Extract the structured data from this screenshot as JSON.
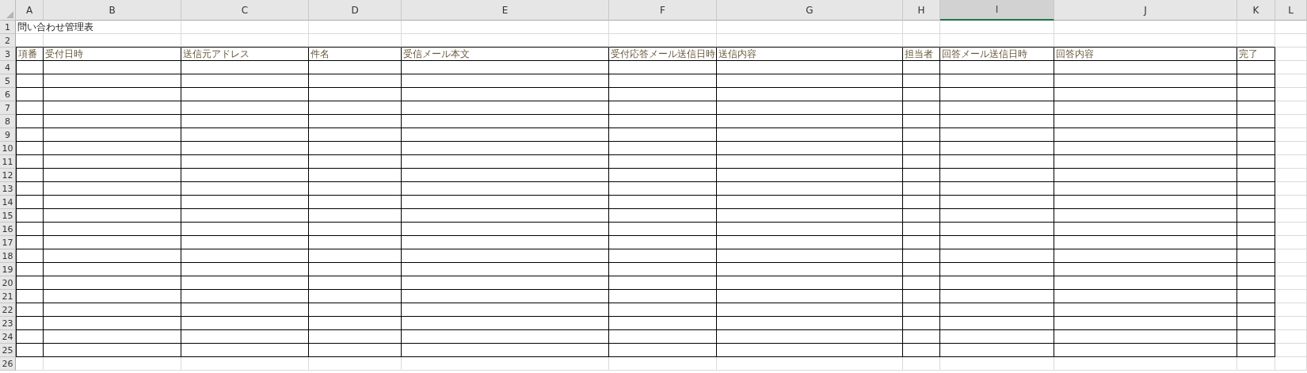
{
  "columns": [
    {
      "label": "A",
      "selected": false
    },
    {
      "label": "B",
      "selected": false
    },
    {
      "label": "C",
      "selected": false
    },
    {
      "label": "D",
      "selected": false
    },
    {
      "label": "E",
      "selected": false
    },
    {
      "label": "F",
      "selected": false
    },
    {
      "label": "G",
      "selected": false
    },
    {
      "label": "H",
      "selected": false
    },
    {
      "label": "I",
      "selected": true
    },
    {
      "label": "J",
      "selected": false
    },
    {
      "label": "K",
      "selected": false
    },
    {
      "label": "L",
      "selected": false
    }
  ],
  "row_numbers": [
    "1",
    "2",
    "3",
    "4",
    "5",
    "6",
    "7",
    "8",
    "9",
    "10",
    "11",
    "12",
    "13",
    "14",
    "15",
    "16",
    "17",
    "18",
    "19",
    "20",
    "21",
    "22",
    "23",
    "24",
    "25",
    "26"
  ],
  "title": "問い合わせ管理表",
  "table_headers": [
    "項番",
    "受付日時",
    "送信元アドレス",
    "件名",
    "受信メール本文",
    "受付応答メール送信日時",
    "送信内容",
    "担当者",
    "回答メール送信日時",
    "回答内容",
    "完了"
  ]
}
